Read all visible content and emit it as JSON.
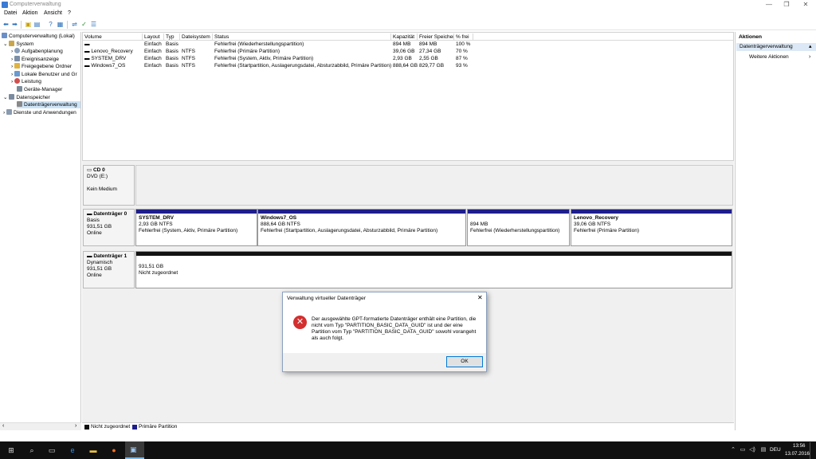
{
  "window": {
    "title": "Computerverwaltung",
    "min_glyph": "—",
    "max_glyph": "❐",
    "close_glyph": "✕"
  },
  "menu": [
    "Datei",
    "Aktion",
    "Ansicht",
    "?"
  ],
  "tree": {
    "root": "Computerverwaltung (Lokal)",
    "system": "System",
    "items": [
      "Aufgabenplanung",
      "Ereignisanzeige",
      "Freigegebene Ordner",
      "Lokale Benutzer und Gr",
      "Leistung",
      "Geräte-Manager"
    ],
    "storage": "Datenspeicher",
    "disk_mgmt": "Datenträgerverwaltung",
    "services": "Dienste und Anwendungen"
  },
  "volumes": {
    "headers": [
      "Volume",
      "Layout",
      "Typ",
      "Dateisystem",
      "Status",
      "Kapazität",
      "Freier Speicher",
      "% frei"
    ],
    "rows": [
      [
        "",
        "Einfach",
        "Basis",
        "",
        "Fehlerfrei (Wiederherstellungspartition)",
        "894 MB",
        "894 MB",
        "100 %"
      ],
      [
        "Lenovo_Recovery",
        "Einfach",
        "Basis",
        "NTFS",
        "Fehlerfrei (Primäre Partition)",
        "39,06 GB",
        "27,34 GB",
        "70 %"
      ],
      [
        "SYSTEM_DRV",
        "Einfach",
        "Basis",
        "NTFS",
        "Fehlerfrei (System, Aktiv, Primäre Partition)",
        "2,93 GB",
        "2,55 GB",
        "87 %"
      ],
      [
        "Windows7_OS",
        "Einfach",
        "Basis",
        "NTFS",
        "Fehlerfrei (Startpartition, Auslagerungsdatei, Absturzabbild, Primäre Partition)",
        "888,64 GB",
        "829,77 GB",
        "93 %"
      ]
    ]
  },
  "disks": {
    "cd": {
      "name": "CD 0",
      "type": "DVD (E:)",
      "status": "Kein Medium"
    },
    "disk0": {
      "name": "Datenträger 0",
      "type": "Basis",
      "size": "931,51 GB",
      "status": "Online",
      "parts": [
        {
          "name": "SYSTEM_DRV",
          "size": "2,93 GB NTFS",
          "status": "Fehlerfrei (System, Aktiv, Primäre Partition)"
        },
        {
          "name": "Windows7_OS",
          "size": "888,64 GB NTFS",
          "status": "Fehlerfrei (Startpartition, Auslagerungsdatei, Absturzabbild, Primäre Partition)"
        },
        {
          "name": "",
          "size": "894 MB",
          "status": "Fehlerfrei (Wiederherstellungspartition)"
        },
        {
          "name": "Lenovo_Recovery",
          "size": "39,06 GB NTFS",
          "status": "Fehlerfrei (Primäre Partition)"
        }
      ]
    },
    "disk1": {
      "name": "Datenträger 1",
      "type": "Dynamisch",
      "size": "931,51 GB",
      "status": "Online",
      "part_size": "931,51 GB",
      "part_status": "Nicht zugeordnet"
    }
  },
  "legend": {
    "unallocated": "Nicht zugeordnet",
    "primary": "Primäre Partition"
  },
  "actions": {
    "header": "Aktionen",
    "section": "Datenträgerverwaltung",
    "more": "Weitere Aktionen"
  },
  "dialog": {
    "title": "Verwaltung virtueller Datenträger",
    "message": "Der ausgewählte GPT-formatierte Datenträger enthält eine Partition, die nicht vom Typ \"PARTITION_BASIC_DATA_GUID\" ist und der eine Partition vom Typ \"PARTITION_BASIC_DATA_GUID\" sowohl vorangeht als auch folgt.",
    "ok": "OK"
  },
  "taskbar": {
    "time": "13:56",
    "date": "13.07.2016",
    "lang": "DEU"
  },
  "colors": {
    "primary_partition": "#1e1e8c",
    "unallocated": "#111111",
    "selection": "#cce4f7",
    "error": "#d32f2f"
  }
}
